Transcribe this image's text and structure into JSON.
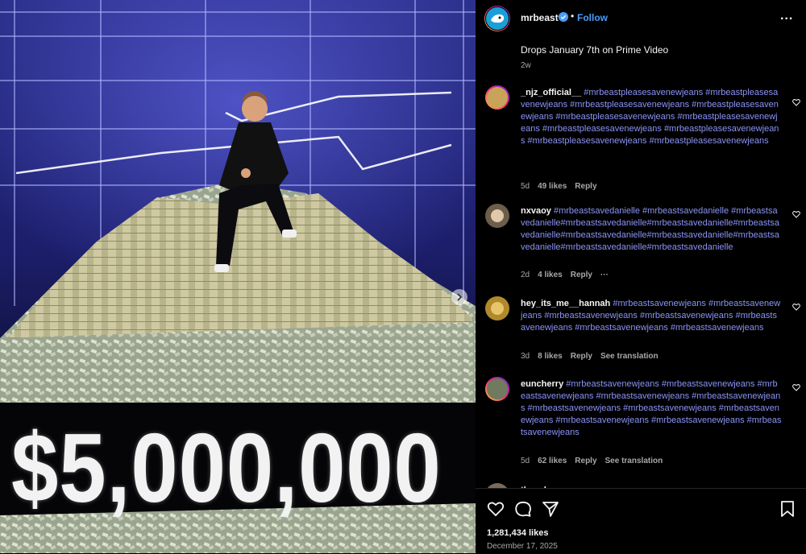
{
  "media": {
    "overlay_text": "$5,000,000"
  },
  "post": {
    "username": "mrbeast",
    "follow_label": "Follow",
    "separator": "•",
    "more_label": "...",
    "caption": "Drops January 7th on Prime Video",
    "caption_age": "2w",
    "likes": "1,281,434 likes",
    "date": "December 17, 2025"
  },
  "comments": [
    {
      "username": "_njz_official__",
      "text": "#mrbeastpleasesavenewjeans #mrbeastpleasesavenewjeans #mrbeastpleasesavenewjeans #mrbeastpleasesavenewjeans #mrbeastpleasesavenewjeans #mrbeastpleasesavenewjeans #mrbeastpleasesavenewjeans #mrbeastpleasesavenewjeans #mrbeastpleasesavenewjeans #mrbeastpleasesavenewjeans",
      "age": "5d",
      "likes": "49 likes",
      "reply": "Reply"
    },
    {
      "username": "nxvaoy",
      "text": "#mrbeastsavedanielle #mrbeastsavedanielle #mrbeastsavedanielle#mrbeastsavedanielle#mrbeastsavedanielle#mrbeastsavedanielle#mrbeastsavedanielle#mrbeastsavedanielle#mrbeastsavedanielle#mrbeastsavedanielle#mrbeastsavedanielle",
      "age": "2d",
      "likes": "4 likes",
      "reply": "Reply",
      "more": "···"
    },
    {
      "username": "hey_its_me__hannah",
      "text": "#mrbeastsavenewjeans #mrbeastsavenewjeans #mrbeastsavenewjeans #mrbeastsavenewjeans #mrbeastsavenewjeans #mrbeastsavenewjeans #mrbeastsavenewjeans",
      "age": "3d",
      "likes": "8 likes",
      "reply": "Reply",
      "translation": "See translation"
    },
    {
      "username": "euncherry",
      "text": "#mrbeastsavenewjeans #mrbeastsavenewjeans #mrbeastsavenewjeans #mrbeastsavenewjeans #mrbeastsavenewjeans #mrbeastsavenewjeans #mrbeastsavenewjeans #mrbeastsavenewjeans #mrbeastsavenewjeans #mrbeastsavenewjeans #mrbeastsavenewjeans",
      "age": "5d",
      "likes": "62 likes",
      "reply": "Reply",
      "translation": "See translation"
    },
    {
      "username": "thee_heeyeon",
      "text": "",
      "age": "",
      "likes": "",
      "reply": ""
    }
  ],
  "icons": {
    "heart": "heart-icon",
    "comment": "comment-icon",
    "share": "share-icon",
    "save": "bookmark-icon",
    "next": "chevron-right-icon",
    "verified": "verified-badge-icon"
  },
  "colors": {
    "background": "#000000",
    "hashtag": "#8b93f5",
    "follow": "#4a9df8",
    "muted": "#a8a8a8"
  }
}
